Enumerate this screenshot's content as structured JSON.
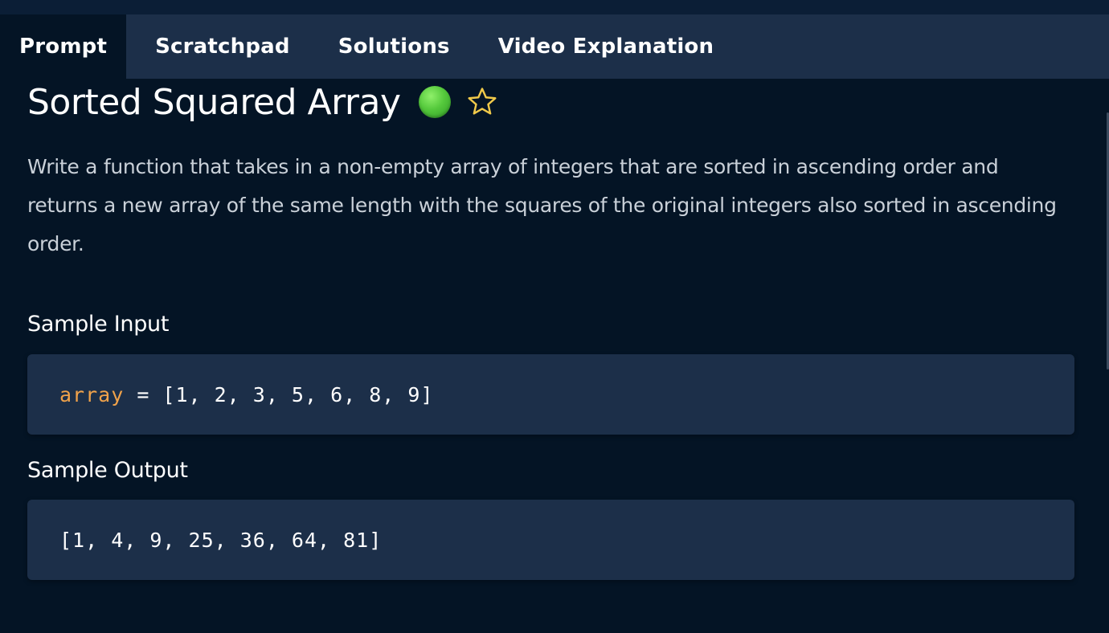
{
  "tabs": [
    {
      "label": "Prompt",
      "active": true
    },
    {
      "label": "Scratchpad",
      "active": false
    },
    {
      "label": "Solutions",
      "active": false
    },
    {
      "label": "Video Explanation",
      "active": false
    }
  ],
  "problem": {
    "title": "Sorted Squared Array",
    "difficulty_icon": "green-dot-icon",
    "difficulty_color": "#4fc33a",
    "favorite_icon": "star-outline-icon",
    "star_color": "#f0c94a",
    "description": "Write a function that takes in a non-empty array of integers that are sorted in ascending order and returns a new array of the same length with the squares of the original integers also sorted in ascending order."
  },
  "sample_input": {
    "label": "Sample Input",
    "var_name": "array",
    "equals": " = ",
    "value": "[1, 2, 3, 5, 6, 8, 9]"
  },
  "sample_output": {
    "label": "Sample Output",
    "value": "[1, 4, 9, 25, 36, 64, 81]"
  },
  "colors": {
    "background": "#041425",
    "tabbar": "#1c2f49",
    "codebox": "#1c2f49",
    "keyword": "#f0a24a"
  }
}
